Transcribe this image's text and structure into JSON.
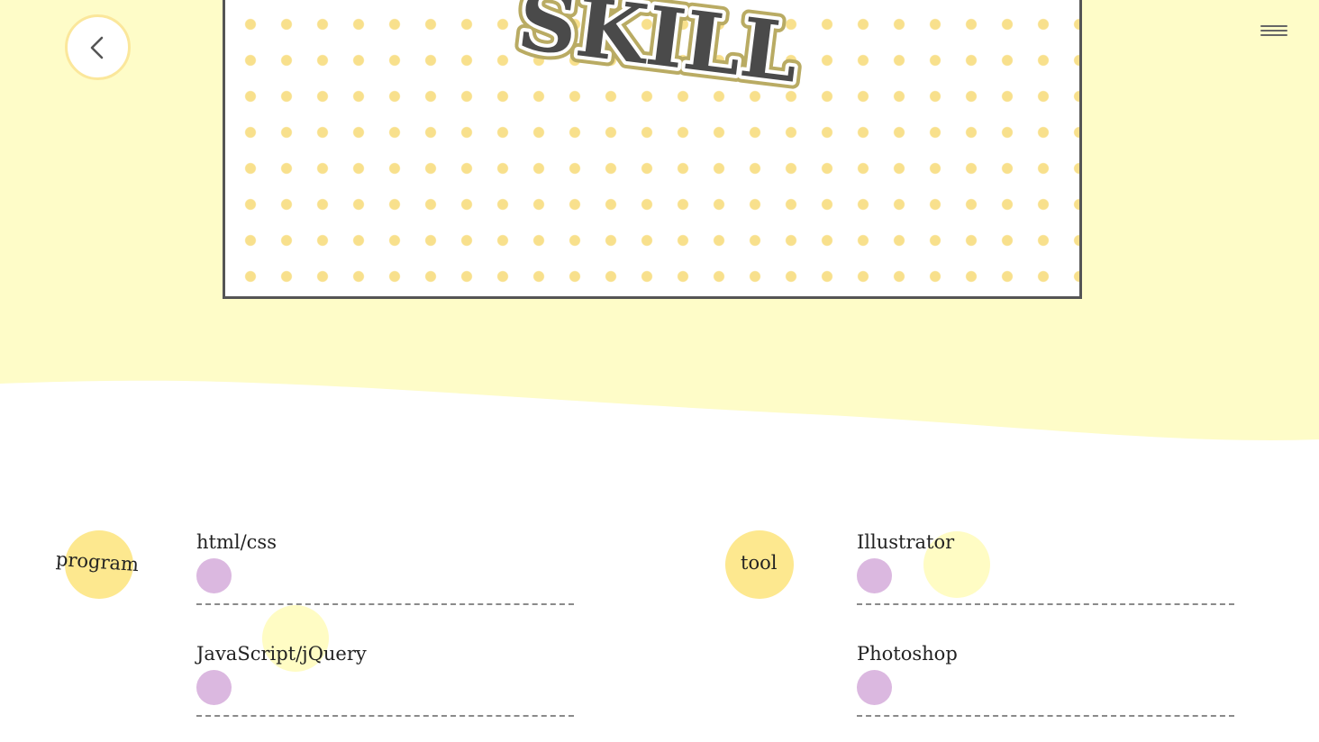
{
  "hero": {
    "title": "SKILL"
  },
  "nav": {
    "back_icon": "chevron-left-icon",
    "menu_icon": "hamburger-menu-icon"
  },
  "colors": {
    "page_bg_yellow": "#fefcc8",
    "badge_yellow": "#fde88f",
    "dot_pattern": "#f8e08c",
    "level_purple": "#dbb8e0",
    "frame_border": "#555555"
  },
  "categories": [
    {
      "label": "program",
      "skills": [
        {
          "name": "html/css",
          "level": 1
        },
        {
          "name": "JavaScript/jQuery",
          "level": 1
        }
      ]
    },
    {
      "label": "tool",
      "skills": [
        {
          "name": "Illustrator",
          "level": 1
        },
        {
          "name": "Photoshop",
          "level": 1
        }
      ]
    }
  ]
}
